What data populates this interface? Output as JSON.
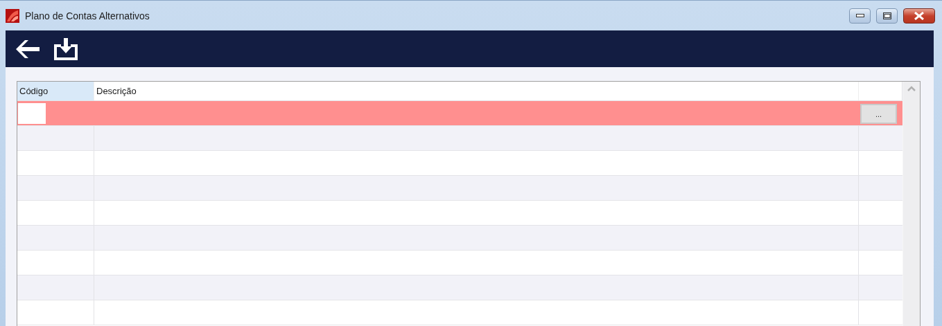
{
  "window": {
    "title": "Plano de Contas Alternativos"
  },
  "toolbar": {
    "buttons": [
      {
        "kind": "back"
      },
      {
        "kind": "save"
      }
    ]
  },
  "grid": {
    "columns": [
      {
        "label": "Código",
        "selected": true
      },
      {
        "label": "Descrição",
        "selected": false
      }
    ],
    "edit_row": {
      "highlighted": true,
      "button": "..."
    }
  }
}
